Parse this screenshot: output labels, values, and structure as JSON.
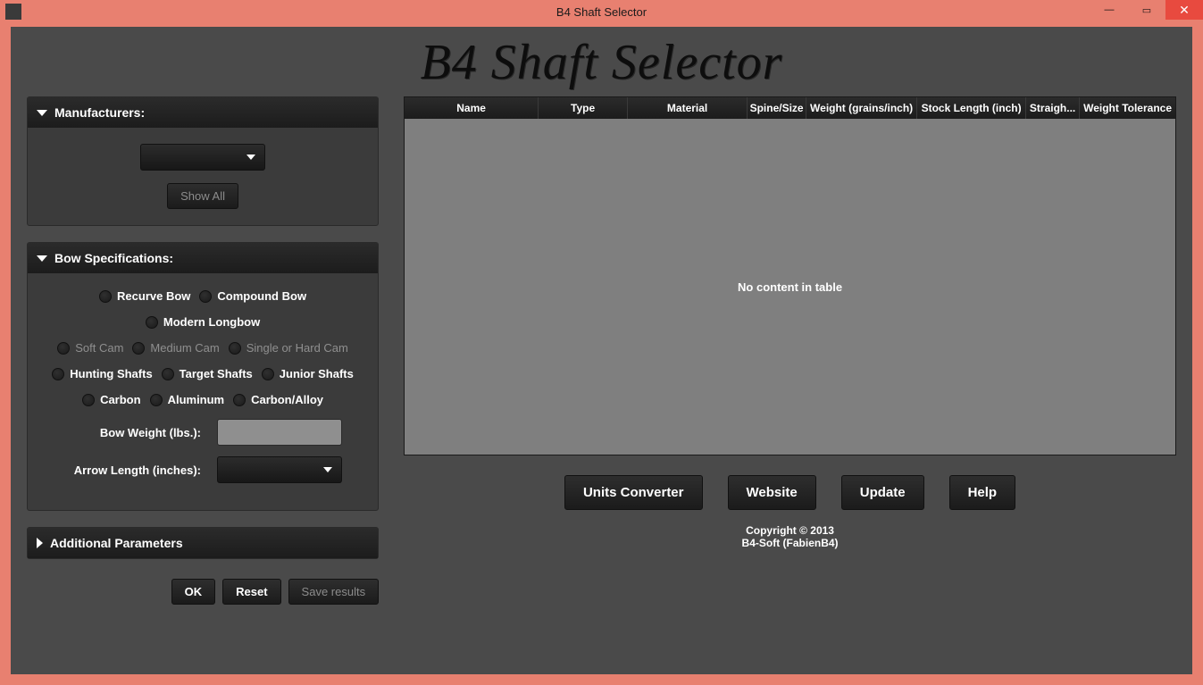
{
  "window": {
    "title": "B4 Shaft Selector",
    "main_title": "B4 Shaft Selector"
  },
  "win_ctrl": {
    "min": "—",
    "max": "▭",
    "close": "✕"
  },
  "panels": {
    "manufacturers": {
      "title": "Manufacturers:",
      "show_all": "Show All"
    },
    "bow_specs": {
      "title": "Bow Specifications:",
      "row1": {
        "recurve": "Recurve Bow",
        "compound": "Compound Bow",
        "modern_longbow": "Modern Longbow"
      },
      "row2": {
        "soft_cam": "Soft Cam",
        "medium_cam": "Medium Cam",
        "single_hard": "Single or Hard Cam"
      },
      "row3": {
        "hunting": "Hunting Shafts",
        "target": "Target Shafts",
        "junior": "Junior Shafts"
      },
      "row4": {
        "carbon": "Carbon",
        "aluminum": "Aluminum",
        "carbon_alloy": "Carbon/Alloy"
      },
      "labels": {
        "bow_weight": "Bow Weight (lbs.):",
        "arrow_length": "Arrow Length (inches):"
      },
      "values": {
        "bow_weight": "",
        "arrow_length": ""
      }
    },
    "additional": {
      "title": "Additional Parameters"
    }
  },
  "actions": {
    "ok": "OK",
    "reset": "Reset",
    "save_results": "Save results"
  },
  "table": {
    "headers": {
      "name": "Name",
      "type": "Type",
      "material": "Material",
      "spine": "Spine/Size",
      "weight": "Weight (grains/inch)",
      "stock_length": "Stock Length (inch)",
      "straight": "Straigh...",
      "weight_tol": "Weight Tolerance"
    },
    "empty": "No content in table"
  },
  "footer": {
    "units_converter": "Units Converter",
    "website": "Website",
    "update": "Update",
    "help": "Help"
  },
  "credits": {
    "line1": "Copyright © 2013",
    "line2": "B4-Soft (FabienB4)"
  }
}
